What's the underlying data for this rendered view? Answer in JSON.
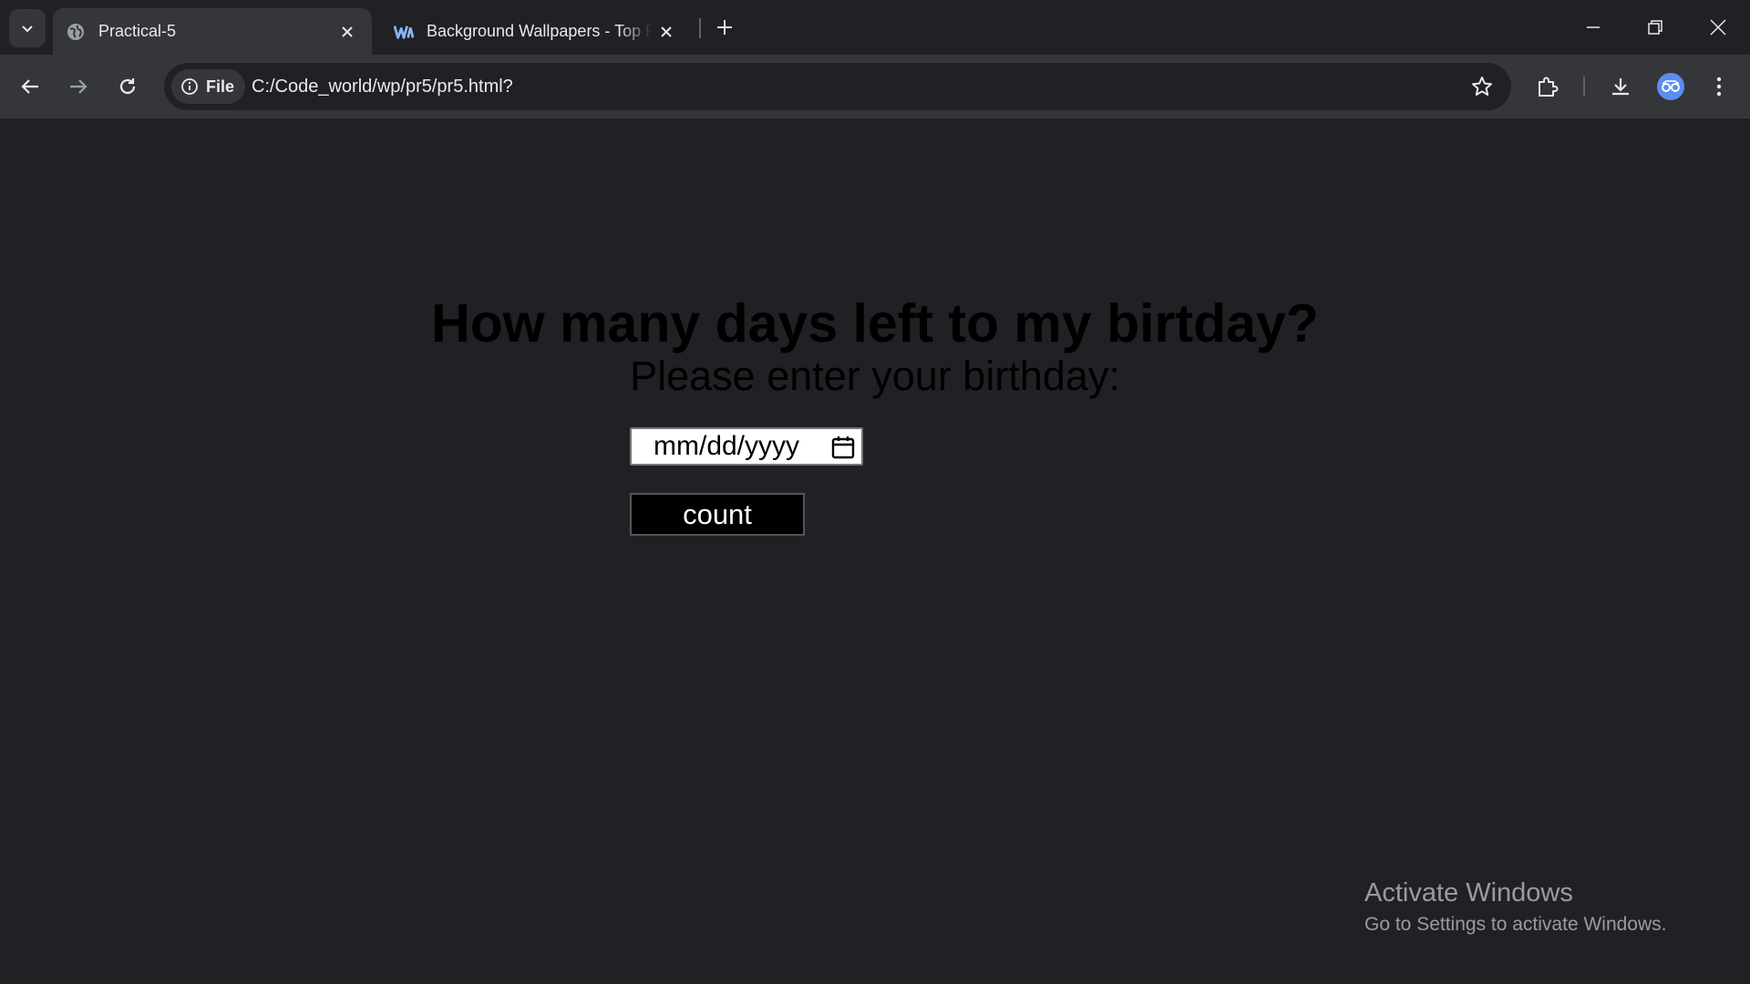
{
  "browser": {
    "tabs": [
      {
        "title": "Practical-5",
        "favicon": "globe-icon",
        "active": true
      },
      {
        "title": "Background Wallpapers - Top Free",
        "favicon": "wallpapers-icon",
        "active": false
      }
    ],
    "site_chip": "File",
    "url": "C:/Code_world/wp/pr5/pr5.html?"
  },
  "page": {
    "heading": "How many days left to my birtday?",
    "subheading": "Please enter your birthday:",
    "date_placeholder": "mm/dd/yyyy",
    "count_button": "count"
  },
  "overlay": {
    "activate_title": "Activate Windows",
    "activate_sub": "Go to Settings to activate Windows."
  },
  "colors": {
    "tabstrip": "#202124",
    "toolbar": "#35363a",
    "button_bg": "#000000",
    "button_text": "#ffffff"
  }
}
